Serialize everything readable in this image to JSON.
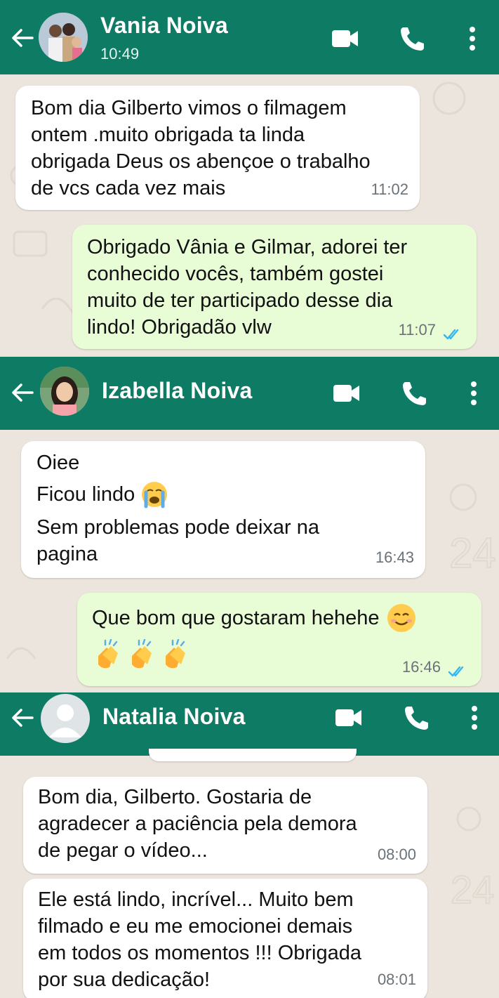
{
  "chats": [
    {
      "contact_name": "Vania Noiva",
      "status": "10:49",
      "messages": [
        {
          "direction": "incoming",
          "text": "Bom dia Gilberto vimos o filmagem\nontem .muito obrigada ta linda\nobrigada Deus os abençoe o trabalho\nde vcs cada vez mais",
          "time": "11:02"
        },
        {
          "direction": "outgoing",
          "text": "Obrigado Vânia e Gilmar, adorei ter\nconhecido vocês, também gostei\nmuito de ter participado desse dia\nlindo! Obrigadão vlw",
          "time": "11:07",
          "read": true
        }
      ]
    },
    {
      "contact_name": "Izabella Noiva",
      "messages": [
        {
          "direction": "incoming",
          "lines": [
            "Oiee",
            "Ficou lindo",
            "Sem problemas pode deixar na\npagina"
          ],
          "emoji": "loudly-crying-face",
          "time": "16:43"
        },
        {
          "direction": "outgoing",
          "text": "Que bom que gostaram hehehe",
          "emoji": "smiling-face",
          "emoji_row": "clapping-hands x3",
          "time": "16:46",
          "read": true
        }
      ]
    },
    {
      "contact_name": "Natalia Noiva",
      "messages": [
        {
          "direction": "incoming",
          "text": "Bom dia, Gilberto. Gostaria de\nagradecer a paciência pela demora\nde pegar o vídeo...",
          "time": "08:00"
        },
        {
          "direction": "incoming",
          "text": "Ele está lindo, incrível... Muito bem\nfilmado e eu me emocionei demais\nem todos os momentos !!! Obrigada\npor sua dedicação!",
          "time": "08:01"
        }
      ]
    }
  ],
  "icons": {
    "back": "arrow-left-icon",
    "video": "video-call-icon",
    "call": "phone-icon",
    "menu": "more-vert-icon",
    "read": "double-check-icon"
  },
  "colors": {
    "header": "#0e7b64",
    "incoming_bubble": "#ffffff",
    "outgoing_bubble": "#e8fcd6",
    "read_ticks": "#34b7f1",
    "wallpaper": "#ece5dd"
  }
}
